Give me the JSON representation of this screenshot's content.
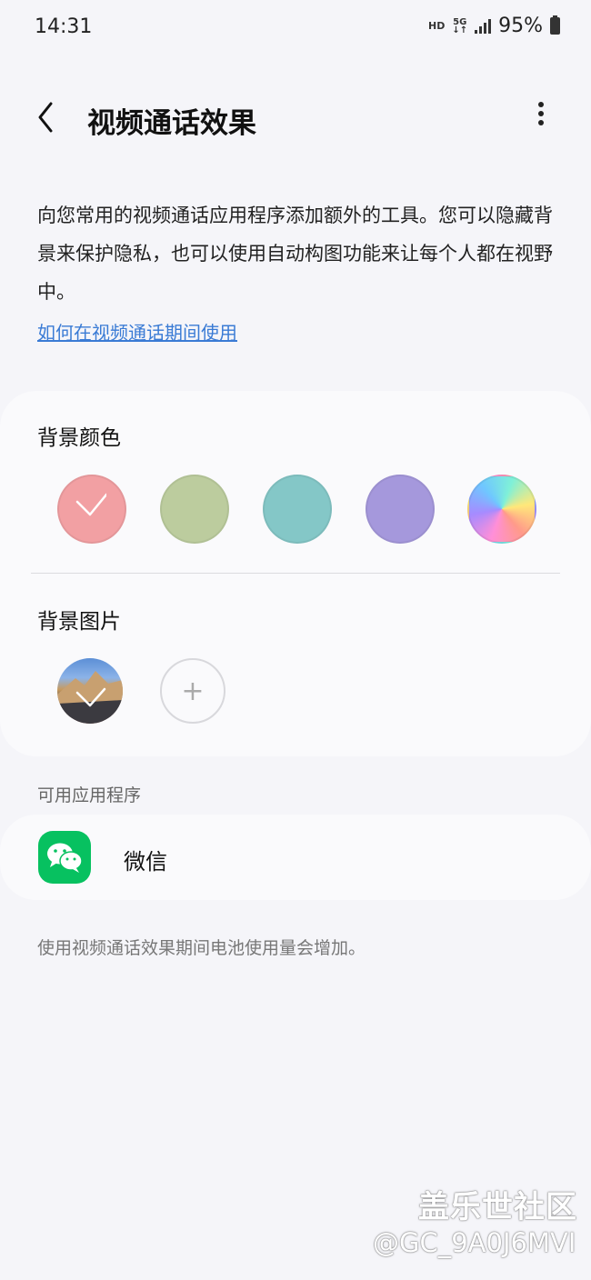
{
  "status_bar": {
    "time": "14:31",
    "hd_label": "HD",
    "network_label": "5G",
    "battery_percent": "95%"
  },
  "header": {
    "title": "视频通话效果"
  },
  "description": "向您常用的视频通话应用程序添加额外的工具。您可以隐藏背景来保护隐私，也可以使用自动构图功能来让每个人都在视野中。",
  "howto_link": "如何在视频通话期间使用",
  "background_color": {
    "title": "背景颜色",
    "swatches": [
      {
        "color": "#f2a0a3",
        "selected": true
      },
      {
        "color": "#bccc9e",
        "selected": false
      },
      {
        "color": "#84c7c7",
        "selected": false
      },
      {
        "color": "#a598dc",
        "selected": false
      },
      {
        "color": "gradient-rainbow",
        "selected": false
      }
    ]
  },
  "background_image": {
    "title": "背景图片",
    "add_symbol": "+"
  },
  "apps": {
    "heading": "可用应用程序",
    "items": [
      {
        "name": "微信",
        "icon": "wechat-icon",
        "color": "#07c160"
      }
    ]
  },
  "battery_note": "使用视频通话效果期间电池使用量会增加。",
  "watermark": {
    "title": "盖乐世社区",
    "user": "@GC_9A0J6MVI"
  }
}
